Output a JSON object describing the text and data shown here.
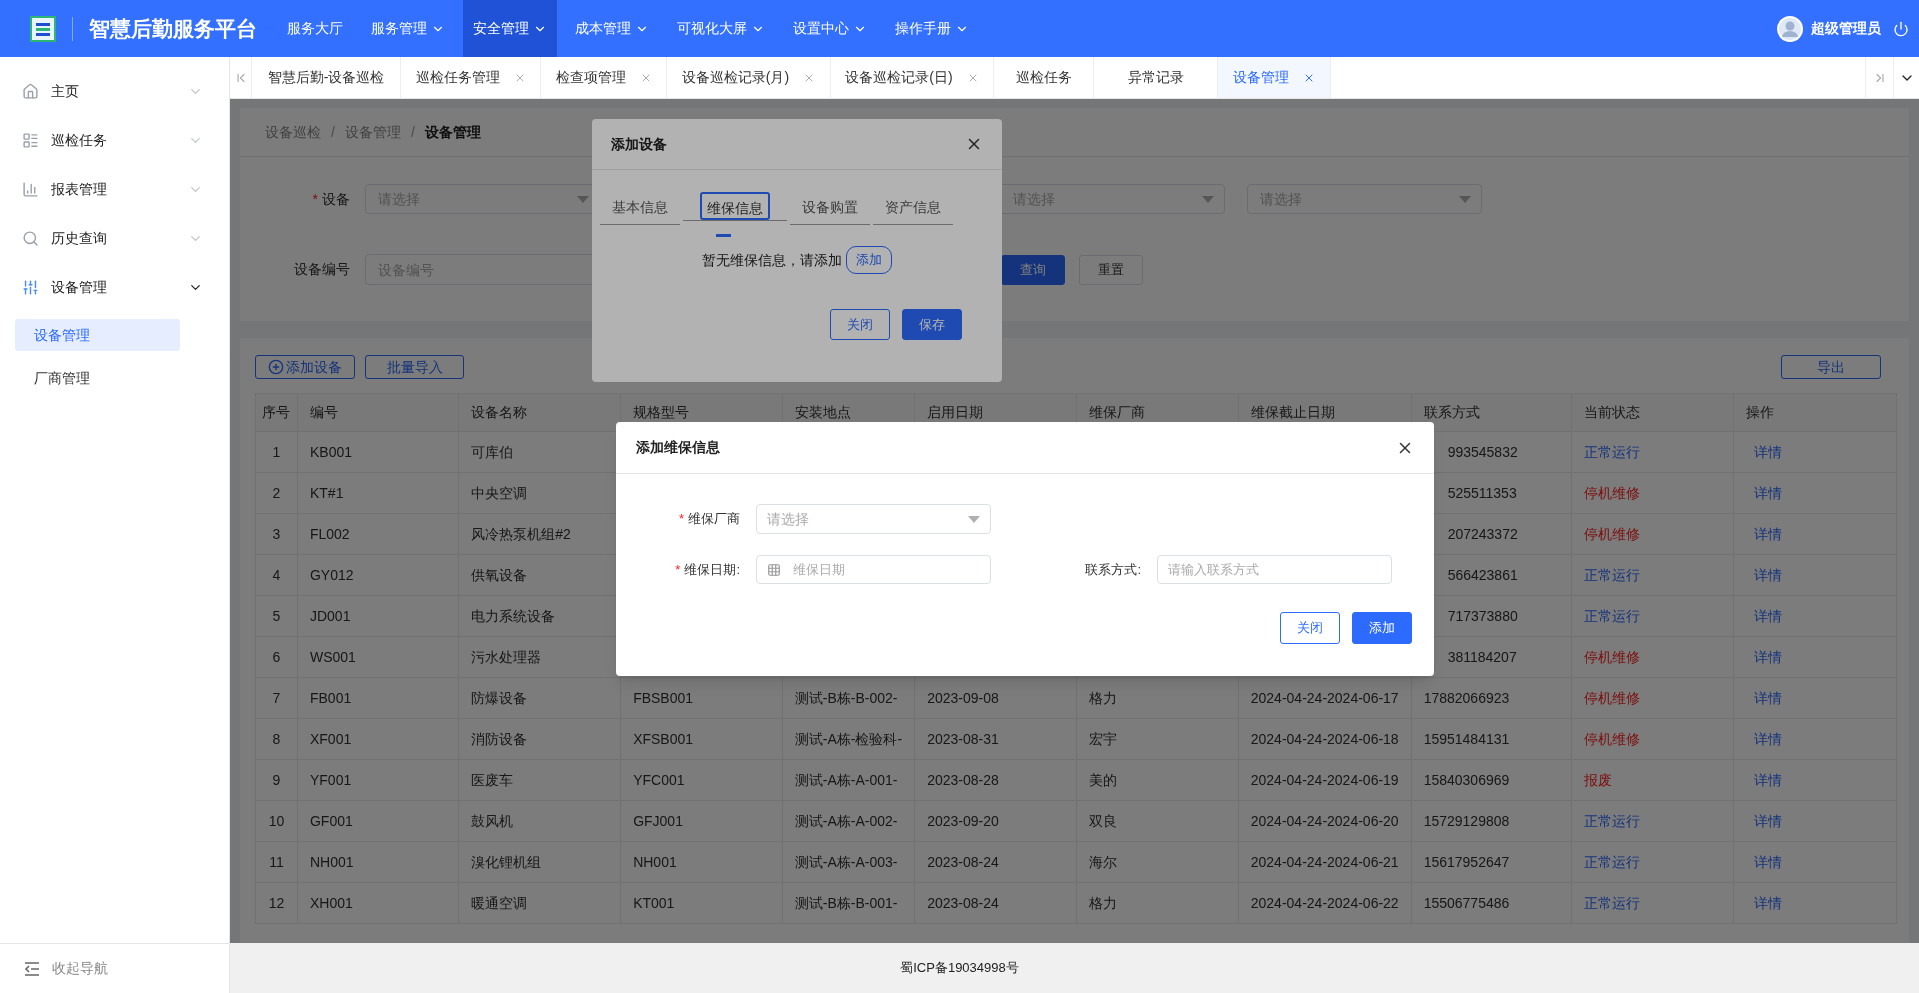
{
  "header": {
    "title": "智慧后勤服务平台",
    "user": "超级管理员",
    "menu": [
      {
        "label": "服务大厅",
        "dropdown": false,
        "selected": false
      },
      {
        "label": "服务管理",
        "dropdown": true,
        "selected": false
      },
      {
        "label": "安全管理",
        "dropdown": true,
        "selected": true
      },
      {
        "label": "成本管理",
        "dropdown": true,
        "selected": false
      },
      {
        "label": "可视化大屏",
        "dropdown": true,
        "selected": false
      },
      {
        "label": "设置中心",
        "dropdown": true,
        "selected": false
      },
      {
        "label": "操作手册",
        "dropdown": true,
        "selected": false
      }
    ]
  },
  "sidebar": {
    "collapse_label": "收起导航",
    "items": [
      {
        "label": "主页",
        "expanded": false
      },
      {
        "label": "巡检任务",
        "expanded": false
      },
      {
        "label": "报表管理",
        "expanded": false
      },
      {
        "label": "历史查询",
        "expanded": false
      },
      {
        "label": "设备管理",
        "expanded": true,
        "children": [
          {
            "label": "设备管理",
            "selected": true
          },
          {
            "label": "厂商管理",
            "selected": false
          }
        ]
      }
    ]
  },
  "tabs": [
    {
      "label": "智慧后勤-设备巡检",
      "closable": false,
      "selected": false
    },
    {
      "label": "巡检任务管理",
      "closable": true,
      "selected": false
    },
    {
      "label": "检查项管理",
      "closable": true,
      "selected": false
    },
    {
      "label": "设备巡检记录(月)",
      "closable": true,
      "selected": false
    },
    {
      "label": "设备巡检记录(日)",
      "closable": true,
      "selected": false
    },
    {
      "label": "巡检任务",
      "closable": false,
      "selected": false
    },
    {
      "label": "异常记录",
      "closable": false,
      "selected": false
    },
    {
      "label": "设备管理",
      "closable": true,
      "selected": true
    }
  ],
  "breadcrumb": {
    "separator": "/",
    "items": [
      "设备巡检",
      "设备管理",
      "设备管理"
    ]
  },
  "filters": {
    "row1": [
      {
        "label": "设备",
        "required_mark": "*",
        "placeholder": "请选择"
      },
      {
        "placeholder": "请选择"
      },
      {
        "placeholder": "请选择"
      }
    ],
    "row2": {
      "label": "设备编号",
      "placeholder": "设备编号"
    },
    "buttons": [
      {
        "label": "查询",
        "kind": "primary"
      },
      {
        "label": "重置",
        "kind": "plain"
      }
    ]
  },
  "toolbar": {
    "add": "添加设备",
    "import": "批量导入",
    "export": "导出"
  },
  "table": {
    "columns": [
      "序号",
      "编号",
      "设备名称",
      "规格型号",
      "安装地点",
      "启用日期",
      "维保厂商",
      "维保截止日期",
      "联系方式",
      "当前状态",
      "操作"
    ],
    "rows": [
      {
        "no": "1",
        "code": "KB001",
        "name": "可库伯",
        "phone": "993545832",
        "status": {
          "text": "正常运行",
          "kind": "running"
        },
        "action": "详情"
      },
      {
        "no": "2",
        "code": "KT#1",
        "name": "中央空调",
        "phone": "525511353",
        "status": {
          "text": "停机维修",
          "kind": "stopped"
        },
        "action": "详情"
      },
      {
        "no": "3",
        "code": "FL002",
        "name": "风冷热泵机组#2",
        "phone": "207243372",
        "status": {
          "text": "停机维修",
          "kind": "stopped"
        },
        "action": "详情"
      },
      {
        "no": "4",
        "code": "GY012",
        "name": "供氧设备",
        "phone": "566423861",
        "status": {
          "text": "正常运行",
          "kind": "running"
        },
        "action": "详情"
      },
      {
        "no": "5",
        "code": "JD001",
        "name": "电力系统设备",
        "phone": "717373880",
        "status": {
          "text": "正常运行",
          "kind": "running"
        },
        "action": "详情"
      },
      {
        "no": "6",
        "code": "WS001",
        "name": "污水处理器",
        "phone": "381184207",
        "status": {
          "text": "停机维修",
          "kind": "stopped"
        },
        "action": "详情"
      },
      {
        "no": "7",
        "code": "FB001",
        "name": "防爆设备",
        "model": "FBSB001",
        "location": "测试-B栋-B-002-",
        "start": "2023-09-08",
        "vendor": "格力",
        "end": "2024-04-24-2024-06-17",
        "phone": "17882066923",
        "status": {
          "text": "停机维修",
          "kind": "stopped"
        },
        "action": "详情"
      },
      {
        "no": "8",
        "code": "XF001",
        "name": "消防设备",
        "model": "XFSB001",
        "location": "测试-A栋-检验科-",
        "start": "2023-08-31",
        "vendor": "宏宇",
        "end": "2024-04-24-2024-06-18",
        "phone": "15951484131",
        "status": {
          "text": "停机维修",
          "kind": "stopped"
        },
        "action": "详情"
      },
      {
        "no": "9",
        "code": "YF001",
        "name": "医废车",
        "model": "YFC001",
        "location": "测试-A栋-A-001-",
        "start": "2023-08-28",
        "vendor": "美的",
        "end": "2024-04-24-2024-06-19",
        "phone": "15840306969",
        "status": {
          "text": "报废",
          "kind": "scrapped"
        },
        "action": "详情"
      },
      {
        "no": "10",
        "code": "GF001",
        "name": "鼓风机",
        "model": "GFJ001",
        "location": "测试-A栋-A-002-",
        "start": "2023-09-20",
        "vendor": "双良",
        "end": "2024-04-24-2024-06-20",
        "phone": "15729129808",
        "status": {
          "text": "正常运行",
          "kind": "running"
        },
        "action": "详情"
      },
      {
        "no": "11",
        "code": "NH001",
        "name": "溴化锂机组",
        "model": "NH001",
        "location": "测试-A栋-A-003-",
        "start": "2023-08-24",
        "vendor": "海尔",
        "end": "2024-04-24-2024-06-21",
        "phone": "15617952647",
        "status": {
          "text": "正常运行",
          "kind": "running"
        },
        "action": "详情"
      },
      {
        "no": "12",
        "code": "XH001",
        "name": "暖通空调",
        "model": "KT001",
        "location": "测试-B栋-B-001-",
        "start": "2023-08-24",
        "vendor": "格力",
        "end": "2024-04-24-2024-06-22",
        "phone": "15506775486",
        "status": {
          "text": "正常运行",
          "kind": "running"
        },
        "action": "详情"
      }
    ]
  },
  "device_dialog": {
    "title": "添加设备",
    "tabs": [
      {
        "label": "基本信息",
        "selected": false
      },
      {
        "label": "维保信息",
        "selected": true
      },
      {
        "label": "设备购置",
        "selected": false
      },
      {
        "label": "资产信息",
        "selected": false
      }
    ],
    "empty_text": "暂无维保信息，请添加",
    "add_button": "添加",
    "buttons": [
      {
        "label": "关闭",
        "kind": "plain"
      },
      {
        "label": "保存",
        "kind": "primary"
      }
    ]
  },
  "maintenance_dialog": {
    "title": "添加维保信息",
    "fields": [
      {
        "label": "维保厂商",
        "required_mark": "*",
        "kind": "select",
        "placeholder": "请选择"
      },
      {
        "label": "维保日期:",
        "required_mark": "*",
        "kind": "date",
        "placeholder": "维保日期"
      },
      {
        "label": "联系方式:",
        "kind": "text",
        "placeholder": "请输入联系方式"
      }
    ],
    "buttons": [
      {
        "label": "关闭",
        "kind": "plain"
      },
      {
        "label": "添加",
        "kind": "primary"
      }
    ]
  },
  "footer": "蜀ICP备19034998号"
}
